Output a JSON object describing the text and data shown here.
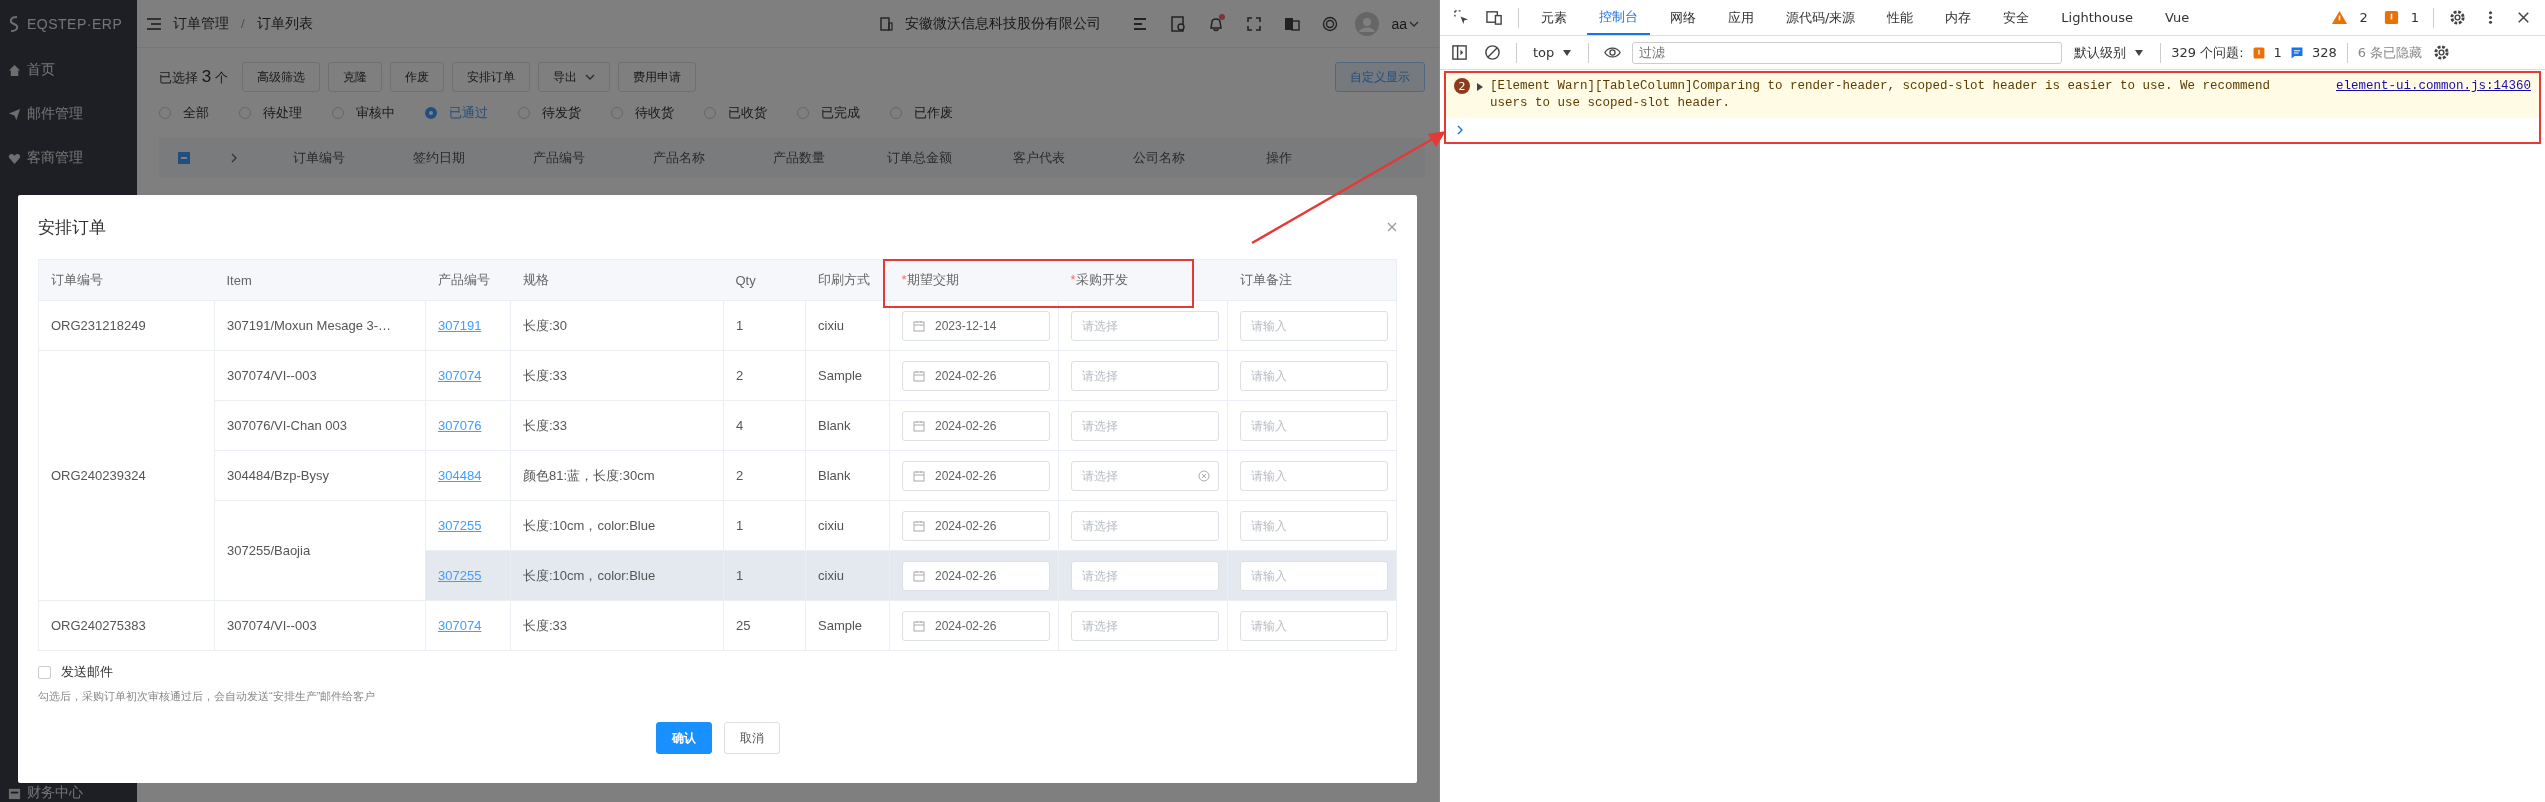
{
  "app": {
    "logo": "EQSTEP·ERP",
    "breadcrumb": [
      "订单管理",
      "订单列表"
    ],
    "company": "安徽微沃信息科技股份有限公司",
    "unread": true,
    "user": "aa",
    "breadcrumb_separator": "/",
    "sidebar": [
      {
        "label": "首页"
      },
      {
        "label": "邮件管理"
      },
      {
        "label": "客商管理"
      }
    ],
    "sidebar_bottom": {
      "label": "财务中心"
    },
    "selection": {
      "prefix": "已选择",
      "count": "3",
      "suffix": "个"
    },
    "actions": [
      {
        "label": "高级筛选",
        "kind": "plain"
      },
      {
        "label": "克隆",
        "kind": "plain"
      },
      {
        "label": "作废",
        "kind": "plain"
      },
      {
        "label": "安排订单",
        "kind": "plain"
      },
      {
        "label": "导出",
        "kind": "dropdown"
      },
      {
        "label": "费用申请",
        "kind": "plain"
      }
    ],
    "custom_display": "自定义显示",
    "status_filters": [
      {
        "label": "全部",
        "selected": false
      },
      {
        "label": "待处理",
        "selected": false
      },
      {
        "label": "审核中",
        "selected": false
      },
      {
        "label": "已通过",
        "selected": true
      },
      {
        "label": "待发货",
        "selected": false
      },
      {
        "label": "待收货",
        "selected": false
      },
      {
        "label": "已收货",
        "selected": false
      },
      {
        "label": "已完成",
        "selected": false
      },
      {
        "label": "已作废",
        "selected": false
      }
    ],
    "select_all": {
      "indeterminate": true
    },
    "columns": [
      "订单编号",
      "签约日期",
      "产品编号",
      "产品名称",
      "产品数量",
      "订单总金额",
      "客户代表",
      "公司名称",
      "操作"
    ]
  },
  "dialog": {
    "title": "安排订单",
    "columns": [
      {
        "label": "订单编号"
      },
      {
        "label": "Item"
      },
      {
        "label": "产品编号"
      },
      {
        "label": "规格"
      },
      {
        "label": "Qty"
      },
      {
        "label": "印刷方式"
      },
      {
        "label": "期望交期",
        "required_mark": "*"
      },
      {
        "label": "采购开发",
        "required_mark": "*"
      },
      {
        "label": "订单备注"
      }
    ],
    "groups": [
      {
        "order": "ORG231218249",
        "items": [
          {
            "item": "307191/Moxun Mesage 3-…",
            "products": [
              {
                "code": "307191",
                "spec": "长度:30",
                "qty": "1",
                "print": "cixiu",
                "date": "2023-12-14",
                "purchaser_placeholder": "请选择",
                "note_placeholder": "请输入",
                "show_clear": false,
                "highlighted": false
              }
            ]
          }
        ]
      },
      {
        "order": "ORG240239324",
        "items": [
          {
            "item": "307074/VI--003",
            "products": [
              {
                "code": "307074",
                "spec": "长度:33",
                "qty": "2",
                "print": "Sample",
                "date": "2024-02-26",
                "purchaser_placeholder": "请选择",
                "note_placeholder": "请输入",
                "show_clear": false,
                "highlighted": false
              }
            ]
          },
          {
            "item": "307076/VI-Chan 003",
            "products": [
              {
                "code": "307076",
                "spec": "长度:33",
                "qty": "4",
                "print": "Blank",
                "date": "2024-02-26",
                "purchaser_placeholder": "请选择",
                "note_placeholder": "请输入",
                "show_clear": false,
                "highlighted": false
              }
            ]
          },
          {
            "item": "304484/Bzp-Bysy",
            "products": [
              {
                "code": "304484",
                "spec": "颜色81:蓝，长度:30cm",
                "qty": "2",
                "print": "Blank",
                "date": "2024-02-26",
                "purchaser_placeholder": "请选择",
                "note_placeholder": "请输入",
                "show_clear": true,
                "highlighted": false
              }
            ]
          },
          {
            "item": "307255/Baojia",
            "products": [
              {
                "code": "307255",
                "spec": "长度:10cm，color:Blue",
                "qty": "1",
                "print": "cixiu",
                "date": "2024-02-26",
                "purchaser_placeholder": "请选择",
                "note_placeholder": "请输入",
                "show_clear": false,
                "highlighted": false
              },
              {
                "code": "307255",
                "spec": "长度:10cm，color:Blue",
                "qty": "1",
                "print": "cixiu",
                "date": "2024-02-26",
                "purchaser_placeholder": "请选择",
                "note_placeholder": "请输入",
                "show_clear": false,
                "highlighted": true
              }
            ]
          }
        ]
      },
      {
        "order": "ORG240275383",
        "items": [
          {
            "item": "307074/VI--003",
            "products": [
              {
                "code": "307074",
                "spec": "长度:33",
                "qty": "25",
                "print": "Sample",
                "date": "2024-02-26",
                "purchaser_placeholder": "请选择",
                "note_placeholder": "请输入",
                "show_clear": false,
                "highlighted": false
              }
            ]
          }
        ]
      }
    ],
    "send_email": {
      "label": "发送邮件",
      "checked": false,
      "hint": "勾选后，采购订单初次审核通过后，会自动发送“安排生产”邮件给客户"
    },
    "buttons": [
      {
        "label": "确认",
        "kind": "primary"
      },
      {
        "label": "取消",
        "kind": "plain"
      }
    ]
  },
  "devtools": {
    "tabs": [
      {
        "label": "元素",
        "selected": false
      },
      {
        "label": "控制台",
        "selected": true
      },
      {
        "label": "网络",
        "selected": false
      },
      {
        "label": "应用",
        "selected": false
      },
      {
        "label": "源代码/来源",
        "selected": false
      },
      {
        "label": "性能",
        "selected": false
      },
      {
        "label": "内存",
        "selected": false
      },
      {
        "label": "安全",
        "selected": false
      },
      {
        "label": "Lighthouse",
        "selected": false
      },
      {
        "label": "Vue",
        "selected": false
      }
    ],
    "warnings": "2",
    "errors": "1",
    "context": "top",
    "filter_placeholder": "过滤",
    "level": "默认级别",
    "issues_label": "329 个问题:",
    "issue_errors": "1",
    "issue_infos": "328",
    "hidden": "6 条已隐藏",
    "message": {
      "count": "2",
      "text": "[Element Warn][TableColumn]Comparing to render-header, scoped-slot header is easier to use. We recommend users to use scoped-slot header.",
      "source": "element-ui.common.js:14360"
    }
  }
}
